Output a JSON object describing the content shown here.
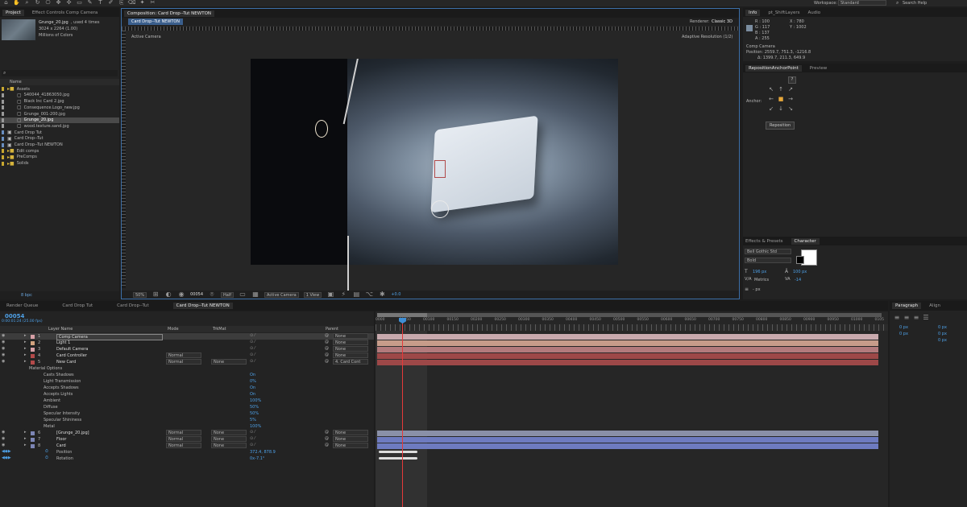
{
  "toolbar": {
    "workspace_label": "Workspace:",
    "workspace_value": "Standard",
    "search_help": "Search Help",
    "tool_icons": [
      "home",
      "hand",
      "zoom",
      "rotate",
      "camera",
      "pan",
      "move",
      "rect",
      "pen",
      "text",
      "brush",
      "clone",
      "eraser",
      "puppet",
      "roto"
    ]
  },
  "project": {
    "tabs": [
      "Project",
      "Effect Controls Comp Camera"
    ],
    "file_name": "Grunge_20.jpg",
    "file_used": ", used 4 times",
    "file_dims": "3024 x 2264 (1.00)",
    "file_colors": "Millions of Colors",
    "search_placeholder": "",
    "name_header": "Name",
    "items": [
      {
        "name": "Assets",
        "type": "folder",
        "level": 0
      },
      {
        "name": "S40044_41863050.jpg",
        "type": "file",
        "level": 1
      },
      {
        "name": "Black Inc Card 2.jpg",
        "type": "file",
        "level": 1
      },
      {
        "name": "Consequence.Logo_new.jpg",
        "type": "file",
        "level": 1
      },
      {
        "name": "Grunge_001-200.jpg",
        "type": "file",
        "level": 1
      },
      {
        "name": "Grunge_20.jpg",
        "type": "file",
        "level": 1
      },
      {
        "name": "wood.texture.sand.jpg",
        "type": "file",
        "level": 1
      },
      {
        "name": "Card Drop Tut",
        "type": "comp",
        "level": 0
      },
      {
        "name": "Card Drop--Tut",
        "type": "comp",
        "level": 0
      },
      {
        "name": "Card Drop--Tut NEWTON",
        "type": "comp",
        "level": 0
      },
      {
        "name": "Edit comps",
        "type": "folder",
        "level": 0
      },
      {
        "name": "PreComps",
        "type": "folder",
        "level": 0
      },
      {
        "name": "Solids",
        "type": "folder",
        "level": 0
      }
    ],
    "bpc": "8 bpc"
  },
  "composition": {
    "tab_label": "Composition: Card Drop--Tut NEWTON",
    "comp_name": "Card Drop--Tut NEWTON",
    "renderer_label": "Renderer:",
    "renderer_value": "Classic 3D",
    "view_label": "Active Camera",
    "adaptive": "Adaptive Resolution (1/2)",
    "zoom": "50%",
    "timecode": "00054",
    "resolution": "Half",
    "camera": "Active Camera",
    "views": "1 View",
    "exposure": "+0.0"
  },
  "info": {
    "tabs": [
      "Info",
      "pt_ShiftLayers",
      "Audio"
    ],
    "r": "R : 100",
    "g": "G : 117",
    "b": "B : 137",
    "a": "A : 255",
    "x": "X : 780",
    "y": "Y : 1002",
    "layer_name": "Comp Camera",
    "position": "Position: 2559.7, 751.3, -1216.8",
    "delta": "Δ: 1399.7, 211.3, 649.9",
    "accent_swatch": "#7b8da0"
  },
  "reposition": {
    "tabs": [
      "RepositionAnchorPoint",
      "Preview"
    ],
    "help": "?",
    "anchor_label": "Anchor:",
    "button": "Reposition"
  },
  "character": {
    "tabs": [
      "Effects & Presets",
      "Character"
    ],
    "font": "Bell Gothic Std",
    "style": "Bold",
    "size": "196 px",
    "leading": "100 px",
    "kerning": "Metrics",
    "tracking": "-14",
    "stroke": "- px"
  },
  "bottom_tabs": [
    "Render Queue",
    "Card Drop Tut",
    "Card Drop--Tut",
    "Card Drop--Tut NEWTON"
  ],
  "timeline": {
    "timecode": "00054",
    "timecode_sub": "0:00:01:24 (25.00 fps)",
    "headers": {
      "layer": "Layer Name",
      "mode": "Mode",
      "trkmat": "TrkMat",
      "parent": "Parent"
    },
    "ruler": [
      "0000",
      "00050",
      "00100",
      "00150",
      "00200",
      "00250",
      "00300",
      "00350",
      "00400",
      "00450",
      "00500",
      "00550",
      "00600",
      "00650",
      "00700",
      "00750",
      "00800",
      "00850",
      "00900",
      "00950",
      "01000",
      "0105"
    ],
    "layers": [
      {
        "num": "1",
        "name": "Comp Camera",
        "mode": "",
        "trk": "",
        "parent": "None",
        "color": "#d7a0a6",
        "bar": "#c8a9ad",
        "selected": true
      },
      {
        "num": "2",
        "name": "Light 1",
        "mode": "",
        "trk": "",
        "parent": "None",
        "color": "#d1a27e",
        "bar": "#c79c8a"
      },
      {
        "num": "3",
        "name": "Default Camera",
        "mode": "",
        "trk": "",
        "parent": "None",
        "color": "#d7a0a6",
        "bar": "#b27a7c"
      },
      {
        "num": "4",
        "name": "Card Controller",
        "mode": "Normal",
        "trk": "",
        "parent": "None",
        "color": "#b34a4a",
        "bar": "#9d4848"
      },
      {
        "num": "5",
        "name": "New Card",
        "mode": "Normal",
        "trk": "None",
        "parent": "4. Card Cont",
        "color": "#b34a4a",
        "bar": "#9d4848"
      }
    ],
    "material_header": "Material Options",
    "material": [
      {
        "name": "Casts Shadows",
        "value": "On"
      },
      {
        "name": "Light Transmission",
        "value": "0%"
      },
      {
        "name": "Accepts Shadows",
        "value": "On"
      },
      {
        "name": "Accepts Lights",
        "value": "On"
      },
      {
        "name": "Ambient",
        "value": "100%"
      },
      {
        "name": "Diffuse",
        "value": "50%"
      },
      {
        "name": "Specular Intensity",
        "value": "50%"
      },
      {
        "name": "Specular Shininess",
        "value": "5%"
      },
      {
        "name": "Metal",
        "value": "100%"
      }
    ],
    "layers2": [
      {
        "num": "6",
        "name": "[Grunge_20.jpg]",
        "mode": "Normal",
        "trk": "None",
        "parent": "None",
        "color": "#7d86b5",
        "bar": "#8a90a8"
      },
      {
        "num": "7",
        "name": "Floor",
        "mode": "Normal",
        "trk": "None",
        "parent": "None",
        "color": "#7d86b5",
        "bar": "#6e7bc0"
      },
      {
        "num": "8",
        "name": "Card",
        "mode": "Normal",
        "trk": "None",
        "parent": "None",
        "color": "#7d86b5",
        "bar": "#6e7bc0"
      }
    ],
    "props": [
      {
        "name": "Position",
        "value": "372.4, 878.9"
      },
      {
        "name": "Rotation",
        "value": "0x-7.1°"
      }
    ]
  },
  "paragraph": {
    "tabs": [
      "Paragraph",
      "Align"
    ],
    "values": [
      "0 px",
      "0 px",
      "0 px",
      "0 px",
      "0 px"
    ]
  }
}
